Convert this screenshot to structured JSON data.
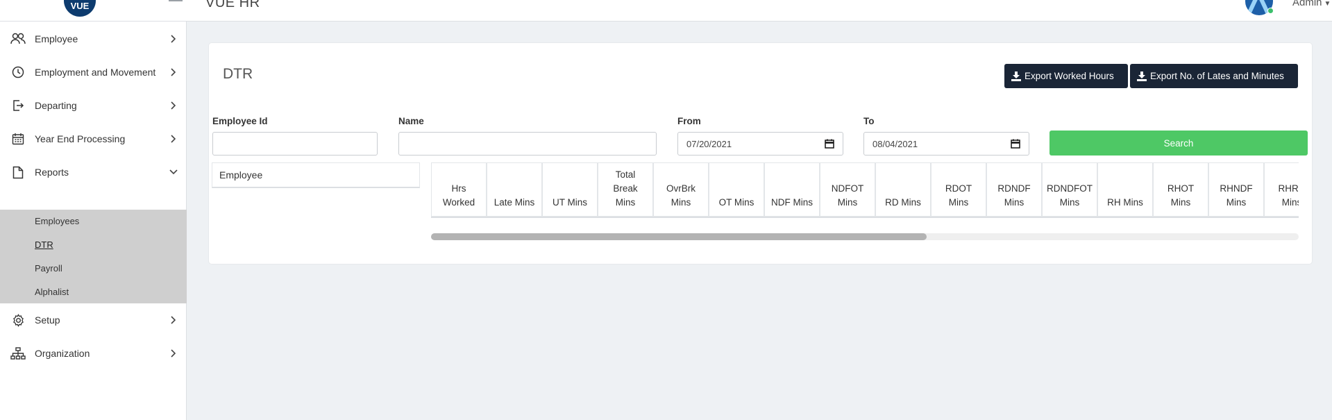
{
  "header": {
    "logo_text": "VUE",
    "app_title": "VUE HR",
    "user_name": "Admin"
  },
  "sidebar": {
    "items": [
      {
        "label": "Employee",
        "icon": "users-icon"
      },
      {
        "label": "Employment and Movement",
        "icon": "clock-icon"
      },
      {
        "label": "Departing",
        "icon": "exit-icon"
      },
      {
        "label": "Year End Processing",
        "icon": "calendar-icon"
      },
      {
        "label": "Reports",
        "icon": "document-icon"
      },
      {
        "label": "Setup",
        "icon": "gear-icon"
      },
      {
        "label": "Organization",
        "icon": "org-chart-icon"
      }
    ],
    "reports_submenu": [
      "Employees",
      "DTR",
      "Payroll",
      "Alphalist"
    ],
    "active_subitem": "DTR"
  },
  "page": {
    "title": "DTR",
    "export_worked_hours": "Export Worked Hours",
    "export_lates": "Export No. of Lates and Minutes"
  },
  "filters": {
    "employee_id_label": "Employee Id",
    "employee_id_value": "",
    "name_label": "Name",
    "name_value": "",
    "from_label": "From",
    "from_value": "07/20/2021",
    "to_label": "To",
    "to_value": "08/04/2021",
    "search_label": "Search"
  },
  "table": {
    "employee_column": "Employee",
    "columns": [
      "Hrs\nWorked",
      "Late Mins",
      "UT Mins",
      "Total\nBreak\nMins",
      "OvrBrk\nMins",
      "OT Mins",
      "NDF Mins",
      "NDFOT\nMins",
      "RD Mins",
      "RDOT\nMins",
      "RDNDF\nMins",
      "RDNDFOT\nMins",
      "RH Mins",
      "RHOT\nMins",
      "RHNDF\nMins",
      "RHRD\nMins"
    ]
  },
  "colors": {
    "dark_button": "#1a2536",
    "search_button": "#4ec865",
    "submenu_bg": "#cfcfcf",
    "logo": "#0d3b6e"
  }
}
